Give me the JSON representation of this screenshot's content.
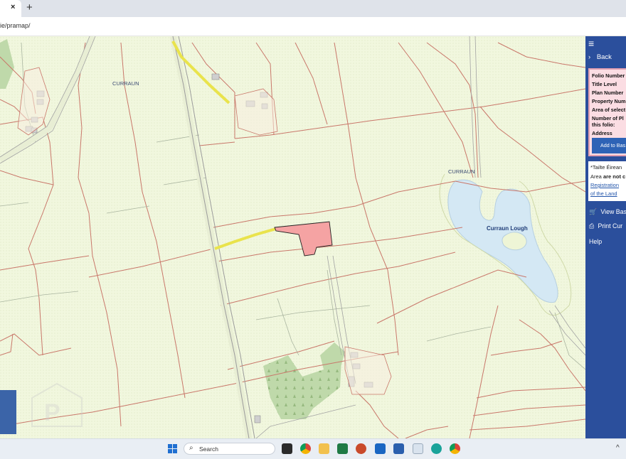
{
  "browser": {
    "tab_close": "×",
    "new_tab": "+",
    "address": "ie/pramap/"
  },
  "map": {
    "place_label_1": "CURRAUN",
    "place_label_2": "CURRAUN",
    "lake_label": "Curraun Lough",
    "colors": {
      "background": "#f1f7de",
      "boundary": "#c9776a",
      "parcel": "#f5a3a3",
      "lake": "#d4e8f4",
      "road": "#e9e34c",
      "forest": "#bcd7a8"
    }
  },
  "sidebar": {
    "menu_icon": "≡",
    "back": "Back",
    "info": {
      "folio_number": "Folio Number",
      "title_level": "Title Level",
      "plan_number": "Plan Number",
      "property_number": "Property Num",
      "area_selected": "Area of select",
      "number_of_plans": "Number of Pl",
      "this_folio": "this folio:",
      "address": "Address"
    },
    "add_button": "Add to Bas",
    "notice": {
      "line1": "*Tailte Éirean",
      "line2": "Area ",
      "line2_bold": "are not c",
      "line3": "Registration",
      "line4": "of the Land"
    },
    "view_basket": "View Bas",
    "print": "Print Cur",
    "help": "Help"
  },
  "taskbar": {
    "search_placeholder": "Search",
    "tray_chevron": "^"
  }
}
